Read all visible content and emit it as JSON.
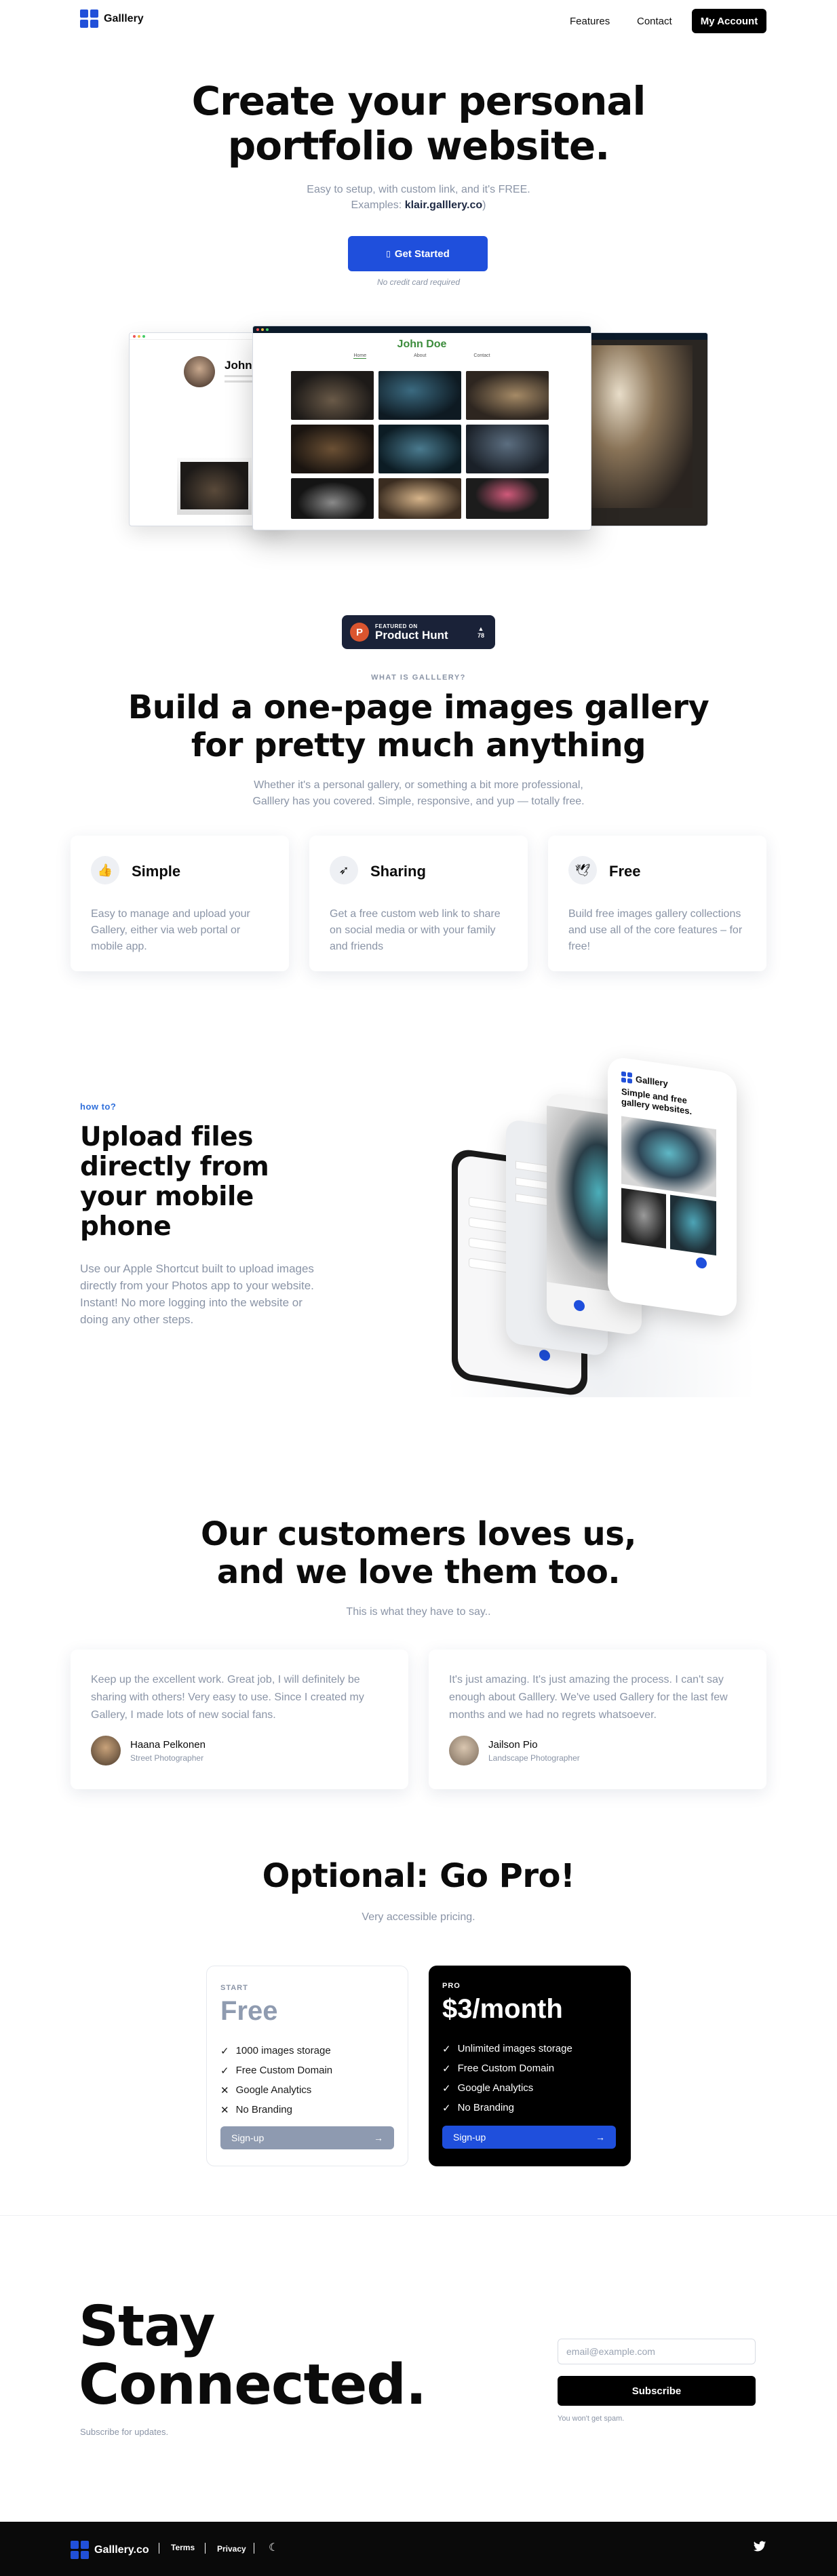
{
  "nav": {
    "brand": "Galllery",
    "links": [
      "Features",
      "Contact"
    ],
    "account_button": "My Account"
  },
  "hero": {
    "title_line1": "Create your personal",
    "title_line2": "portfolio website.",
    "subtitle": "Easy to setup, with custom link, and it's FREE.",
    "examples_prefix": "Examples: ",
    "examples_link": "klair.galllery.co",
    "examples_suffix": ")",
    "cta_label": "Get Started",
    "cta_icon": "rocket-icon",
    "note": "No credit card required"
  },
  "mockup": {
    "left_name": "John D",
    "center_name": "John Doe",
    "center_tabs": [
      "Home",
      "About",
      "Contact"
    ]
  },
  "product_hunt": {
    "featured": "FEATURED ON",
    "name": "Product Hunt",
    "count": "78"
  },
  "what": {
    "eyebrow": "WHAT IS GALLLERY?",
    "title_line1": "Build a one-page images gallery",
    "title_line2": "for pretty much anything",
    "desc_line1": "Whether it's a personal gallery, or something a bit more professional,",
    "desc_line2": "Galllery has you covered. Simple, responsive, and yup — totally free."
  },
  "features": [
    {
      "icon": "thumbs-up-icon",
      "title": "Simple",
      "text": "Easy to manage and upload your Gallery, either via web portal or mobile app."
    },
    {
      "icon": "send-icon",
      "title": "Sharing",
      "text": "Get a free custom web link to share on social media or with your family and friends"
    },
    {
      "icon": "bird-icon",
      "title": "Free",
      "text": "Build free images gallery collections and use all of the core features – for free!"
    }
  ],
  "upload": {
    "eyebrow": "how to?",
    "title": "Upload files directly from your mobile phone",
    "text": "Use our Apple Shortcut built to upload images directly from your Photos app to your website. Instant! No more logging into the website or doing any other steps.",
    "phone_brand": "Galllery",
    "phone_tagline": "Simple and free gallery websites."
  },
  "testimonials": {
    "title_line1": "Our customers loves us,",
    "title_line2": "and we love them too.",
    "subtitle": "This is what they have to say..",
    "items": [
      {
        "quote": "Keep up the excellent work. Great job, I will definitely be sharing with others! Very easy to use. Since I created my Gallery, I made lots of new social fans.",
        "name": "Haana Pelkonen",
        "role": "Street Photographer"
      },
      {
        "quote": "It's just amazing. It's just amazing the process. I can't say enough about Galllery. We've used Gallery for the last few months and we had no regrets whatsoever.",
        "name": "Jailson Pio",
        "role": "Landscape Photographer"
      }
    ]
  },
  "pricing": {
    "title": "Optional: Go Pro!",
    "subtitle": "Very accessible pricing.",
    "plans": [
      {
        "tier": "START",
        "price": "Free",
        "features": [
          {
            "text": "1000 images storage",
            "included": true
          },
          {
            "text": "Free Custom Domain",
            "included": true
          },
          {
            "text": "Google Analytics",
            "included": false
          },
          {
            "text": "No Branding",
            "included": false
          }
        ],
        "button": "Sign-up"
      },
      {
        "tier": "PRO",
        "price": "$3/month",
        "features": [
          {
            "text": "Unlimited images storage",
            "included": true
          },
          {
            "text": "Free Custom Domain",
            "included": true
          },
          {
            "text": "Google Analytics",
            "included": true
          },
          {
            "text": "No Branding",
            "included": true
          }
        ],
        "button": "Sign-up"
      }
    ]
  },
  "stay": {
    "title_line1": "Stay",
    "title_line2": "Connected.",
    "subtitle": "Subscribe for updates.",
    "email_placeholder": "email@example.com",
    "subscribe_button": "Subscribe",
    "spam_note": "You won't get spam."
  },
  "footer": {
    "brand": "Galllery.co",
    "links": [
      "Terms",
      "Privacy"
    ],
    "theme_icon": "moon-icon",
    "social_icon": "twitter-icon"
  },
  "colors": {
    "accent": "#1f4fdc",
    "muted": "#8a94a6",
    "dark": "#000000"
  }
}
